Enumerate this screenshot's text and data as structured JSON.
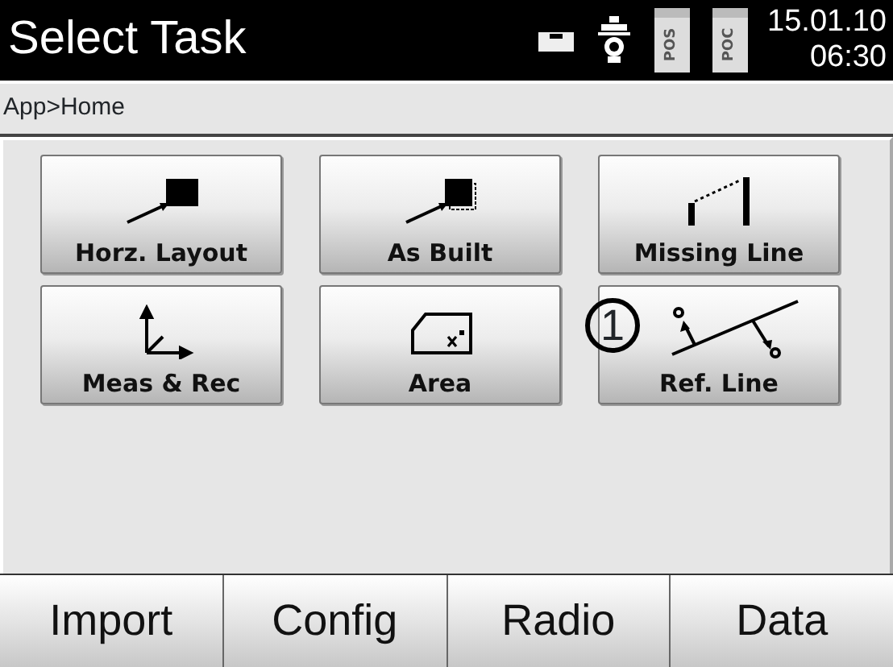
{
  "header": {
    "title": "Select Task",
    "status_icons": [
      {
        "kind": "level"
      },
      {
        "kind": "prism"
      },
      {
        "kind": "battery",
        "label": "POS"
      },
      {
        "kind": "battery",
        "label": "POC"
      }
    ],
    "date": "15.01.10",
    "time": "06:30"
  },
  "breadcrumb": "App>Home",
  "tasks": [
    {
      "label": "Horz. Layout",
      "kind": "layout"
    },
    {
      "label": "As Built",
      "kind": "asbuilt"
    },
    {
      "label": "Missing Line",
      "kind": "missing"
    },
    {
      "label": "Meas & Rec",
      "kind": "measrec"
    },
    {
      "label": "Area",
      "kind": "area"
    },
    {
      "label": "Ref. Line",
      "kind": "refline",
      "callout": "1"
    }
  ],
  "bottom_buttons": [
    "Import",
    "Config",
    "Radio",
    "Data"
  ]
}
